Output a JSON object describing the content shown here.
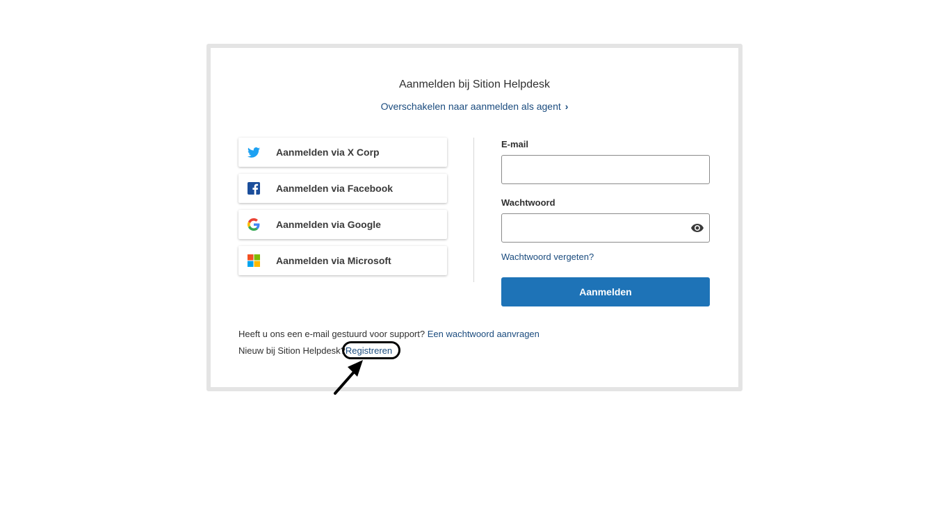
{
  "login": {
    "title": "Aanmelden bij Sition Helpdesk",
    "agent_link": "Overschakelen naar aanmelden als agent",
    "agent_chevron": "›"
  },
  "social": [
    {
      "label": "Aanmelden via X Corp",
      "icon": "twitter-bird-icon"
    },
    {
      "label": "Aanmelden via Facebook",
      "icon": "facebook-f-icon"
    },
    {
      "label": "Aanmelden via Google",
      "icon": "google-g-icon"
    },
    {
      "label": "Aanmelden via Microsoft",
      "icon": "microsoft-logo-icon"
    }
  ],
  "form": {
    "email_label": "E-mail",
    "email_value": "",
    "password_label": "Wachtwoord",
    "password_value": "",
    "forgot_link": "Wachtwoord vergeten?",
    "submit_label": "Aanmelden"
  },
  "footer": {
    "support_text": "Heeft u ons een e-mail gestuurd voor support?",
    "support_link": "Een wachtwoord aanvragen",
    "new_text": "Nieuw bij Sition Helpdesk?",
    "register_link": "Registreren"
  },
  "colors": {
    "primary": "#1e73b7",
    "link": "#1a4b7e",
    "twitter": "#1da1f2",
    "facebook": "#1877f2"
  }
}
